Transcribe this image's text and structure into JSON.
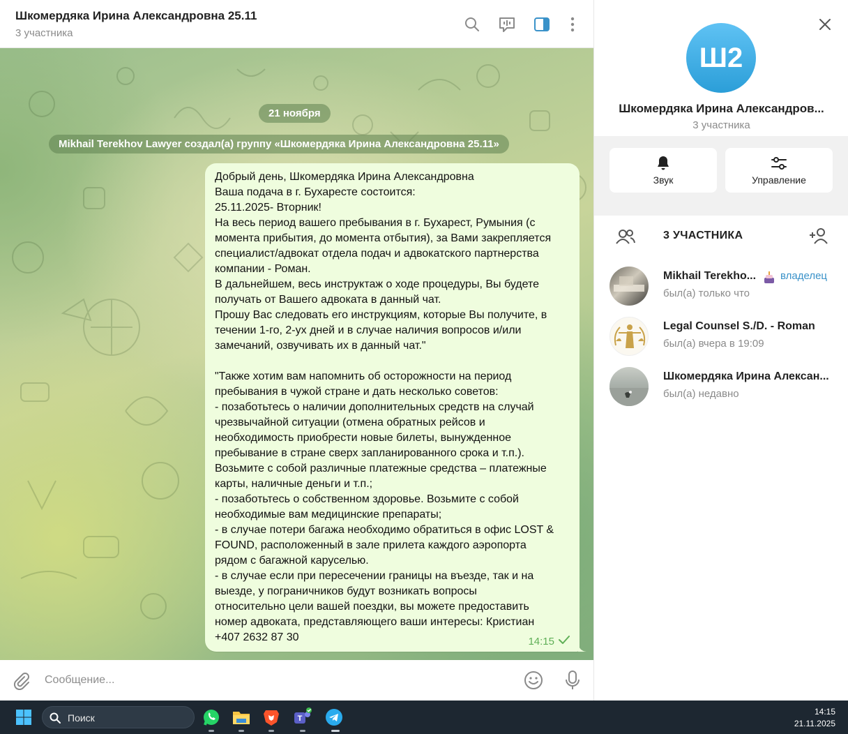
{
  "chat": {
    "title": "Шкомердяка Ирина Александровна 25.11",
    "subtitle": "3 участника",
    "date_label": "21 ноября",
    "service_message": "Mikhail Terekhov Lawyer создал(а) группу «Шкомердяка Ирина Александровна 25.11»",
    "message": {
      "lines": [
        "Добрый день, Шкомердяка Ирина Александровна",
        "Ваша подача в г. Бухаресте состоится:",
        "25.11.2025- Вторник!",
        "На весь период вашего пребывания в г. Бухарест, Румыния (с",
        "момента прибытия, до момента отбытия), за Вами закрепляется",
        "специалист/адвокат отдела подач и адвокатского партнерства",
        "компании - Роман.",
        "В дальнейшем, весь инструктаж о ходе процедуры, Вы будете",
        "получать от Вашего адвоката в данный чат.",
        "Прошу Вас следовать его инструкциям, которые Вы получите, в",
        "течении 1-го, 2-ух дней и в случае наличия вопросов и/или",
        "замечаний, озвучивать их в данный чат.\"",
        "",
        "\"Также хотим вам напомнить об осторожности на период",
        "пребывания в чужой стране и дать несколько советов:",
        "- позаботьтесь о наличии дополнительных средств на случай",
        "чрезвычайной ситуации (отмена обратных рейсов и",
        "необходимость приобрести новые билеты, вынужденное",
        "пребывание в стране сверх запланированного срока и т.п.).",
        "Возьмите с собой различные платежные средства – платежные",
        "карты, наличные деньги и т.п.;",
        "- позаботьтесь о собственном здоровье. Возьмите с собой",
        "необходимые вам медицинские препараты;",
        "- в случае потери багажа необходимо обратиться в офис LOST &",
        "FOUND, расположенный в зале прилета каждого аэропорта",
        "рядом с багажной каруселью.",
        "- в случае если при пересечении границы на въезде, так и на",
        "выезде, у пограничников будут возникать вопросы",
        "относительно цели вашей поездки, вы можете предоставить",
        "номер адвоката, представляющего ваши интересы: Кристиан",
        "+407 2632 87 30"
      ],
      "time": "14:15"
    },
    "composer_placeholder": "Сообщение..."
  },
  "panel": {
    "avatar_initials": "Ш2",
    "group_name": "Шкомердяка Ирина Александров...",
    "group_count": "3 участника",
    "actions": {
      "sound": "Звук",
      "manage": "Управление"
    },
    "members_title": "3 УЧАСТНИКА",
    "members": [
      {
        "name": "Mikhail Terekho...",
        "status": "был(а) только что",
        "role": "владелец"
      },
      {
        "name": "Legal Counsel S./D. - Roman",
        "status": "был(а) вчера в 19:09",
        "role": ""
      },
      {
        "name": "Шкомердяка Ирина Алексан...",
        "status": "был(а) недавно",
        "role": ""
      }
    ]
  },
  "taskbar": {
    "search_label": "Поиск",
    "time": "14:15",
    "date": "21.11.2025"
  },
  "colors": {
    "accent": "#3a92c9",
    "bubble": "#effdde",
    "time_green": "#5faf57",
    "avatar_blue": "#2b9ed8"
  }
}
